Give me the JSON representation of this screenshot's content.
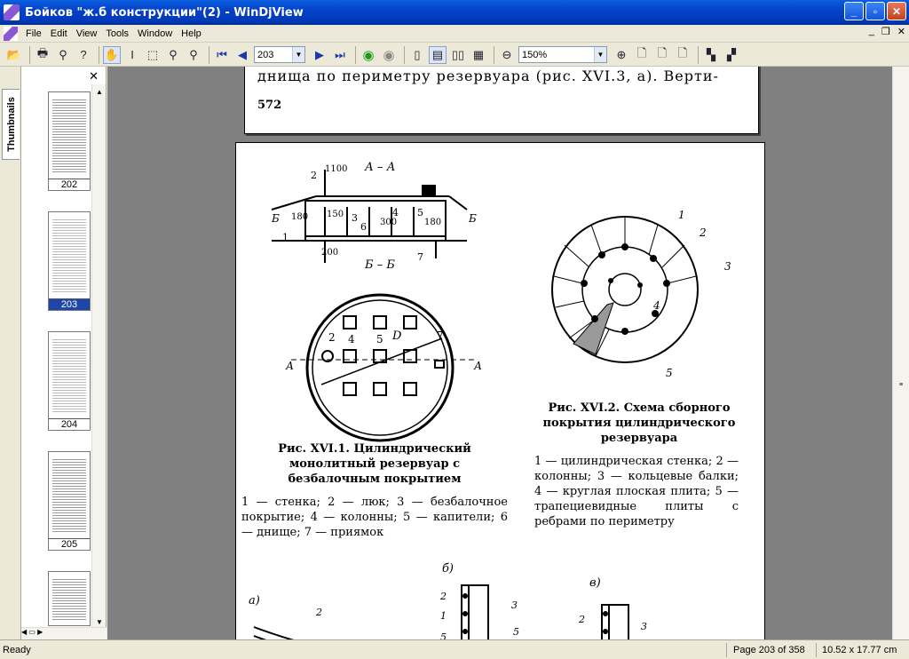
{
  "window": {
    "title": "Бойков \"ж.б  конструкции\"(2) - WinDjView"
  },
  "menu": [
    "File",
    "Edit",
    "View",
    "Tools",
    "Window",
    "Help"
  ],
  "toolbar": {
    "page_value": "203",
    "zoom_value": "150%"
  },
  "sidebar": {
    "tab_label": "Thumbnails",
    "thumbnails": [
      "202",
      "203",
      "204",
      "205"
    ],
    "selected": "203"
  },
  "page_prev": {
    "text": "днища по периметру резервуара  (рис. XVI.3, а). Верти-",
    "page_number": "572"
  },
  "page_current": {
    "fig1": {
      "section_aa": "А – А",
      "section_bb": "Б – Б",
      "label_b": "Б",
      "label_a": "А",
      "dims": [
        "1100",
        "150",
        "180",
        "300",
        "180",
        "200"
      ],
      "nums": [
        "1",
        "2",
        "3",
        "4",
        "5",
        "6",
        "7"
      ],
      "d": "D",
      "caption": "Рис. XVI.1. Цилиндрический монолитный резервуар с безбалочным покрытием",
      "legend": "1 — стенка;  2 — люк;  3 — безбалочное покрытие;  4 — колонны;  5 — капители;  6 — днище;  7 — приямок"
    },
    "fig2": {
      "nums": [
        "1",
        "2",
        "3",
        "4",
        "5"
      ],
      "caption": "Рис. XVI.2. Схема сборного покрытия цилиндрического резервуара",
      "legend": "1 — цилиндрическая стенка; 2 — колонны; 3 — кольцевые балки; 4 — круглая плоская плита;  5 — трапециевидные плиты с ребрами по периметру"
    },
    "fig3": {
      "labels": [
        "а)",
        "б)",
        "в)"
      ],
      "nums": [
        "1",
        "2",
        "3",
        "5"
      ]
    }
  },
  "status": {
    "ready": "Ready",
    "page": "Page 203 of 358",
    "size": "10.52 x 17.77 cm"
  }
}
